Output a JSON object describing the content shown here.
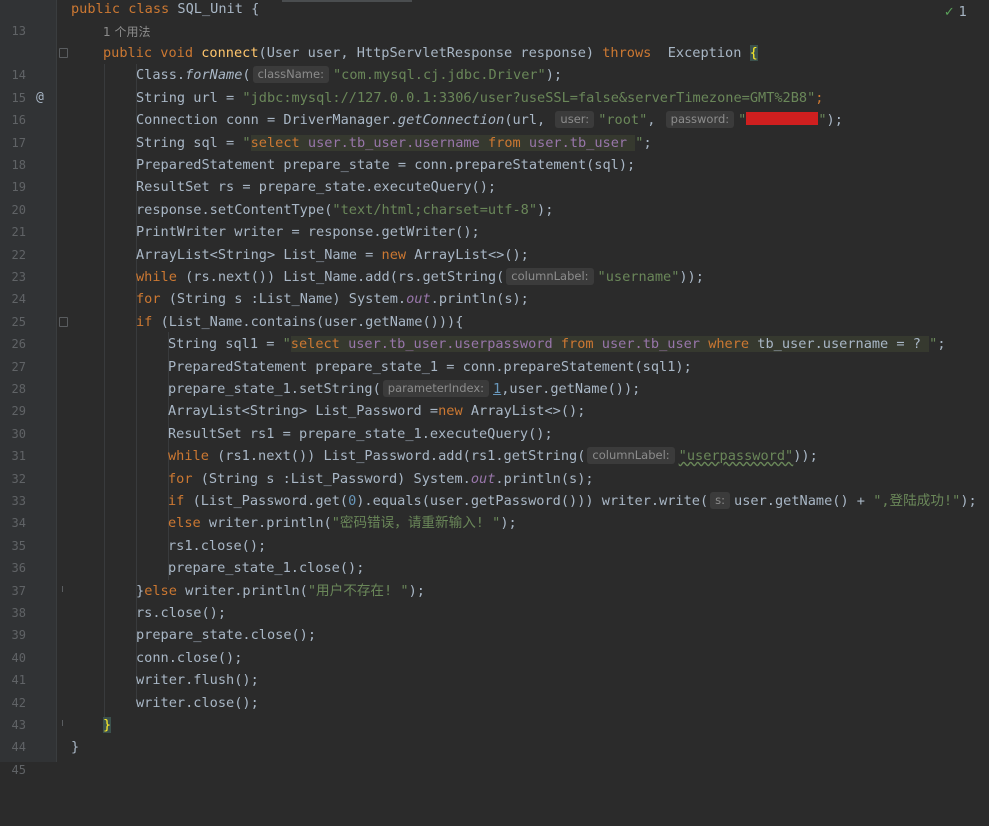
{
  "editor": {
    "inspection": {
      "icon": "check-icon",
      "count": "1"
    },
    "usage_hint": "1 个用法",
    "override_marker": "@",
    "line_numbers": [
      "13",
      "14",
      "15",
      "16",
      "17",
      "18",
      "19",
      "20",
      "21",
      "22",
      "23",
      "24",
      "25",
      "26",
      "27",
      "28",
      "29",
      "30",
      "31",
      "32",
      "33",
      "34",
      "35",
      "36",
      "37",
      "38",
      "39",
      "40",
      "41",
      "42",
      "43",
      "44",
      "45"
    ],
    "code": {
      "l13": {
        "a": "public class ",
        "b": "SQL_Unit {"
      },
      "l14": {
        "a": "public void ",
        "fn": "connect",
        "b": "(User user, HttpServletResponse response) ",
        "kw": "throws ",
        "c": " Exception ",
        "brace": "{"
      },
      "l15": {
        "a": "Class.",
        "it": "forName",
        "b": "(",
        "hint": "className:",
        "str": "\"com.mysql.cj.jdbc.Driver\"",
        "c": ");"
      },
      "l16": {
        "a": "String url = ",
        "str": "\"jdbc:mysql://127.0.0.1:3306/user?useSSL=false&serverTimezone=GMT%2B8\"",
        "c": ";"
      },
      "l17": {
        "a": "Connection conn = DriverManager.",
        "it": "getConnection",
        "b": "(url, ",
        "hint1": "user:",
        "str1": "\"root\"",
        "c": ", ",
        "hint2": "password:",
        "str2a": "\"",
        "str2b": "\"",
        "d": ");"
      },
      "l18": {
        "a": "String sql = ",
        "q1": "\"",
        "s1": "select ",
        "s2": "user.tb_user.username ",
        "s3": "from ",
        "s4": "user.tb_user ",
        "q2": "\"",
        "c": ";"
      },
      "l19": {
        "a": "PreparedStatement prepare_state = conn.prepareStatement(sql);"
      },
      "l20": {
        "a": "ResultSet rs = prepare_state.executeQuery();"
      },
      "l21": {
        "a": "response.setContentType(",
        "str": "\"text/html;charset=utf-8\"",
        "c": ");"
      },
      "l22": {
        "a": "PrintWriter writer = response.getWriter();"
      },
      "l23": {
        "a": "ArrayList<String> List_Name = ",
        "kw": "new ",
        "b": "ArrayList<>();"
      },
      "l24": {
        "kw": "while ",
        "a": "(rs.next()) List_Name.add(rs.getString(",
        "hint": "columnLabel:",
        "str": "\"username\"",
        "c": "));"
      },
      "l25": {
        "kw": "for ",
        "a": "(String s :List_Name) System.",
        "it": "out",
        "b": ".println(s);"
      },
      "l26": {
        "kw": "if ",
        "a": "(List_Name.contains(user.getName())){"
      },
      "l27": {
        "a": "String sql1 = ",
        "q1": "\"",
        "s1": "select ",
        "s2": "user.tb_user.userpassword ",
        "s3": "from ",
        "s4": "user.tb_user ",
        "s5": "where ",
        "s6": "tb_user.username = ? ",
        "q2": "\"",
        "c": ";"
      },
      "l28": {
        "a": "PreparedStatement prepare_state_1 = conn.prepareStatement(sql1);"
      },
      "l29": {
        "a": "prepare_state_1.setString(",
        "hint": "parameterIndex:",
        "num": "1",
        "b": ",user.getName());"
      },
      "l30": {
        "a": "ArrayList<String> List_Password =",
        "kw": "new ",
        "b": "ArrayList<>();"
      },
      "l31": {
        "a": "ResultSet rs1 = prepare_state_1.executeQuery();"
      },
      "l32": {
        "kw": "while ",
        "a": "(rs1.next()) List_Password.add(rs1.getString(",
        "hint": "columnLabel:",
        "str": "\"userpassword\"",
        "c": "));"
      },
      "l33": {
        "kw": "for ",
        "a": "(String s :List_Password) System.",
        "it": "out",
        "b": ".println(s);"
      },
      "l34": {
        "kw": "if ",
        "a": "(List_Password.get(",
        "num": "0",
        "b": ").equals(user.getPassword())) writer.write(",
        "hint": "s:",
        "c": "user.getName() + ",
        "str": "\",登陆成功!\"",
        "d": ");"
      },
      "l35": {
        "kw": "else ",
        "a": "writer.println(",
        "str": "\"密码错误，请重新输入! \"",
        "c": ");"
      },
      "l36": {
        "a": "rs1.close();"
      },
      "l37": {
        "a": "prepare_state_1.close();"
      },
      "l38": {
        "a": "}",
        "kw": "else ",
        "b": "writer.println(",
        "str": "\"用户不存在! \"",
        "c": ");"
      },
      "l39": {
        "a": "rs.close();"
      },
      "l40": {
        "a": "prepare_state.close();"
      },
      "l41": {
        "a": "conn.close();"
      },
      "l42": {
        "a": "writer.flush();"
      },
      "l43": {
        "a": "writer.close();"
      },
      "l44": {
        "a": "}"
      },
      "l45": {
        "a": "}"
      }
    }
  }
}
